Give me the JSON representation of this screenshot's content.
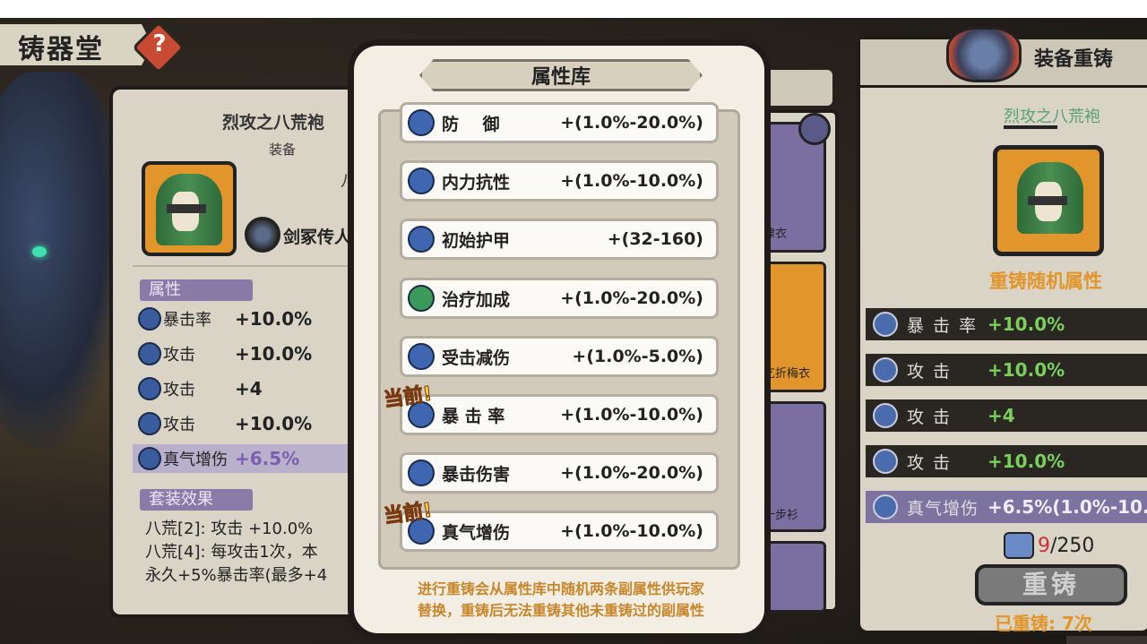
{
  "screen": {
    "title": "铸器堂",
    "help_icon": "question-icon"
  },
  "left": {
    "equip_name": "烈攻之八荒袍",
    "equip_sub": "装备",
    "owner_name": "剑冢传人",
    "owner_char": "八",
    "attr_label": "属性",
    "stats": [
      {
        "icon": "crit-icon",
        "name": "暴击率",
        "value": "+10.0%"
      },
      {
        "icon": "sword-icon",
        "name": "攻击",
        "value": "+10.0%"
      },
      {
        "icon": "sword-icon",
        "name": "攻击",
        "value": "+4"
      },
      {
        "icon": "sword-icon",
        "name": "攻击",
        "value": "+10.0%"
      },
      {
        "icon": "qi-icon",
        "name": "真气增伤",
        "value": "+6.5%"
      }
    ],
    "set_label": "套装效果",
    "set_lines": [
      "八荒[2]: 攻击 +10.0%",
      "八荒[4]: 每攻击1次，本",
      "永久+5%暴击率(最多+4"
    ]
  },
  "middle": {
    "items": [
      "棣衣",
      "乞折梅衣",
      "十步衫"
    ]
  },
  "modal": {
    "title": "属性库",
    "rows": [
      {
        "icon": "shield-icon",
        "name": "防    御",
        "range": "+(1.0%-20.0%)",
        "current": false
      },
      {
        "icon": "swirl-icon",
        "name": "内力抗性",
        "range": "+(1.0%-10.0%)",
        "current": false
      },
      {
        "icon": "armor-icon",
        "name": "初始护甲",
        "range": "+(32-160)",
        "current": false
      },
      {
        "icon": "heal-icon",
        "name": "治疗加成",
        "range": "+(1.0%-20.0%)",
        "current": false
      },
      {
        "icon": "damage-reduce-icon",
        "name": "受击减伤",
        "range": "+(1.0%-5.0%)",
        "current": false
      },
      {
        "icon": "crit-icon",
        "name": "暴 击 率",
        "range": "+(1.0%-10.0%)",
        "current": true
      },
      {
        "icon": "crit-damage-icon",
        "name": "暴击伤害",
        "range": "+(1.0%-20.0%)",
        "current": false
      },
      {
        "icon": "qi-icon",
        "name": "真气增伤",
        "range": "+(1.0%-10.0%)",
        "current": true
      }
    ],
    "current_tag": "当前!",
    "footer_line1": "进行重铸会从属性库中随机两条副属性供玩家",
    "footer_line2": "替换，重铸后无法重铸其他未重铸过的副属性"
  },
  "right": {
    "title": "装备重铸",
    "equip_name": "烈攻之八荒袍",
    "random_label": "重铸随机属性",
    "stats": [
      {
        "icon": "crit-icon",
        "name": "暴 击 率",
        "value": "+10.0%"
      },
      {
        "icon": "sword-icon",
        "name": "攻    击",
        "value": "+10.0%"
      },
      {
        "icon": "sword-icon",
        "name": "攻    击",
        "value": "+4"
      },
      {
        "icon": "sword-icon",
        "name": "攻    击",
        "value": "+10.0%"
      },
      {
        "icon": "qi-icon",
        "name": "真气增伤",
        "value": "+6.5%(1.0%-10."
      }
    ],
    "cost_current": "9",
    "cost_total": "/250",
    "recast_button": "重铸",
    "recast_count": "已重铸: 7次"
  },
  "colors": {
    "accent_orange": "#e2952a",
    "highlight_purple": "#7d73a0",
    "green_value": "#7ad05a",
    "footer_text": "#c8862a"
  }
}
